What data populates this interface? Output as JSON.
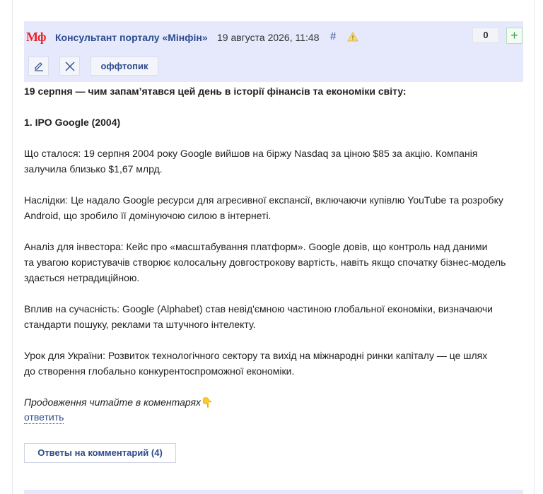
{
  "comment": {
    "logo_text": "Мф",
    "author": "Консультант порталу «Мінфін»",
    "date": "19 августа 2026, 11:48",
    "hash": "#",
    "score": "0",
    "plus": "+",
    "offtopic_label": "оффтопик",
    "paragraphs": {
      "title": "19 серпня — чим запам’ятався цей день в історії фінансів та економіки світу:",
      "heading": "1. IPO Google (2004)",
      "p1a": "Що сталося: 19 серпня 2004 року Google вийшов на біржу Nasdaq за ціною $85 за акцію. Компанія",
      "p1b": "залучила близько $1,67 млрд.",
      "p2a": "Наслідки: Це надало Google ресурси для агресивної експансії, включаючи купівлю YouTube та розробку",
      "p2b": "Android, що зробило її домінуючою силою в інтернеті.",
      "p3a": "Аналіз для інвестора: Кейс про «масштабування платформ». Google довів, що контроль над даними",
      "p3b": "та увагою користувачів створює колосальну довгострокову вартість, навіть якщо спочатку бізнес-модель",
      "p3c": "здається нетрадиційною.",
      "p4a": "Вплив на сучасність: Google (Alphabet) став невід'ємною частиною глобальної економіки, визначаючи",
      "p4b": "стандарти пошуку, реклами та штучного інтелекту.",
      "p5a": "Урок для України: Розвиток технологічного сектору та вихід на міжнародні ринки капіталу — це шлях",
      "p5b": "до створення глобально конкурентоспроможної економіки.",
      "continue": "Продовження читайте в коментарях",
      "continue_emoji": "👇"
    },
    "reply_label": "ответить",
    "answers_label": "Ответы на комментарий (4)"
  },
  "colors": {
    "header_bg": "#e6e9fb",
    "link": "#2d4b8e",
    "logo": "#e8232b",
    "plus": "#3aa14a",
    "warning": "#f2c94c"
  },
  "icons": {
    "edit": "pencil-icon",
    "close": "close-icon",
    "warning": "warning-icon"
  }
}
